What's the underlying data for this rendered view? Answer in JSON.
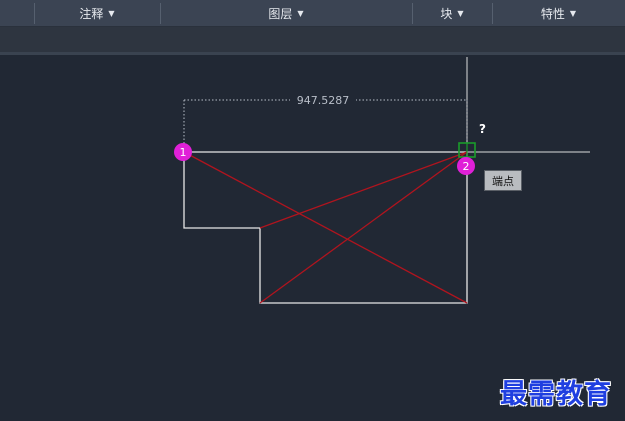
{
  "ribbon": {
    "annotate_label": "注释",
    "layers_label": "图层",
    "block_label": "块",
    "properties_label": "特性",
    "dropdown_glyph": "▼"
  },
  "drawing": {
    "dimension_value": "947.5287",
    "grip_1_label": "1",
    "grip_2_label": "2",
    "cursor_prompt": "?",
    "snap_tooltip": "端点",
    "colors": {
      "geometry": "#e6e6e6",
      "diagonals": "#b0141e",
      "grip": "#e020d8",
      "snap_marker": "#1a9c2a",
      "crosshair": "#dcdcdc"
    }
  },
  "watermark": {
    "text": "最需教育"
  }
}
